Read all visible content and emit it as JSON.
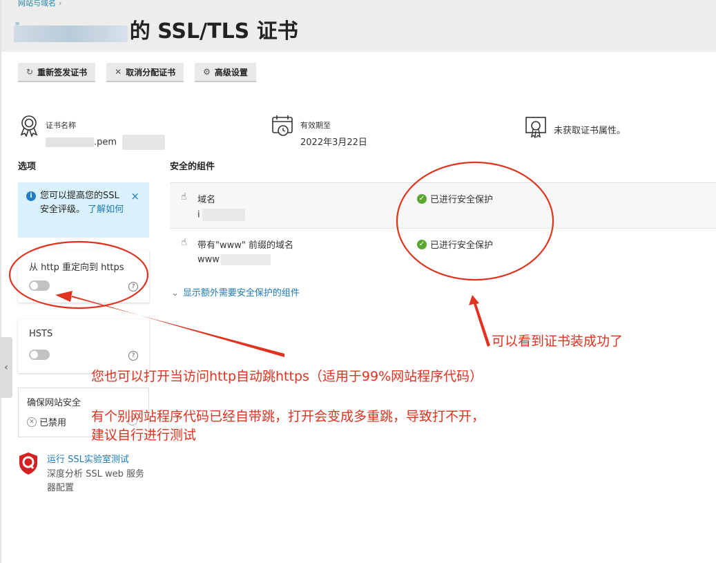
{
  "breadcrumb": {
    "text": "网站与域名",
    "chevron": "›"
  },
  "title": {
    "domain": "i.......com",
    "suffix": "的 SSL/TLS 证书"
  },
  "toolbar": {
    "reissue_label": "重新签发证书",
    "unassign_label": "取消分配证书",
    "advanced_label": "高级设置"
  },
  "cert": {
    "name_label": "证书名称",
    "name_value": ".pem",
    "expiry_label": "有效期至",
    "expiry_value": "2022年3月22日",
    "props_text": "未获取证书属性。"
  },
  "options": {
    "section_title": "选项",
    "info": {
      "text": "您可以提高您的SSL 安全评级。",
      "link": "了解如何",
      "close": "×"
    },
    "redirect_label": "从 http 重定向到 https",
    "hsts_label": "HSTS",
    "help_glyph": "?",
    "secure_site": {
      "label": "确保网站安全",
      "state": "已禁用"
    }
  },
  "ssllab": {
    "link": "运行 SSL实验室测试",
    "desc": "深度分析 SSL web 服务器配置"
  },
  "components": {
    "section_title": "安全的组件",
    "rows": [
      {
        "name": "域名",
        "value": "i",
        "status": "已进行安全保护"
      },
      {
        "name": "带有\"www\" 前缀的域名",
        "value": "www",
        "status": "已进行安全保护"
      }
    ],
    "show_more": "显示额外需要安全保护的组件"
  },
  "side_tab_glyph": "‹",
  "annotations": {
    "success": "可以看到证书装成功了",
    "redirect_tip": "您也可以打开当访问http自动跳https（适用于99%网站程序代码）",
    "warning_line1": "有个别网站程序代码已经自带跳，打开会变成多重跳，导致打不开，",
    "warning_line2": "建议自行进行测试",
    "color": "#e0321e"
  }
}
